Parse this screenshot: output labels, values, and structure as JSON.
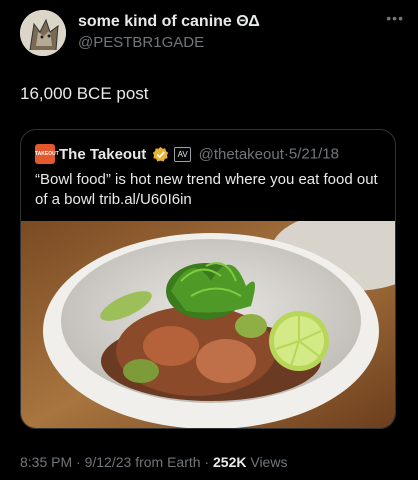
{
  "author": {
    "display_name": "some kind of canine ΘΔ",
    "handle": "@PESTBR1GADE",
    "avatar_icon": "fox-sketch-avatar"
  },
  "more_icon": "more-options-icon",
  "post": {
    "text": "16,000 BCE post"
  },
  "quoted_tweet": {
    "logo_text": "TAKEOUT",
    "name": "The Takeout",
    "badge_label": "AV",
    "handle": "@thetakeout",
    "separator": "·",
    "date": "5/21/18",
    "text": "“Bowl food” is hot new trend where you eat food out of a bowl trib.al/U60I6in",
    "media_description_icon": "bowl-food-photo"
  },
  "meta": {
    "time": "8:35 PM",
    "sep1": "·",
    "date": "9/12/23 from Earth",
    "sep2": "·",
    "views_count": "252K",
    "views_label": "Views"
  },
  "colors": {
    "background": "#000000",
    "primary_text": "#e7e9ea",
    "secondary_text": "#71767b",
    "border": "#2f3336",
    "verified_gold": "#e8b234",
    "takeout_orange": "#e3582c"
  }
}
